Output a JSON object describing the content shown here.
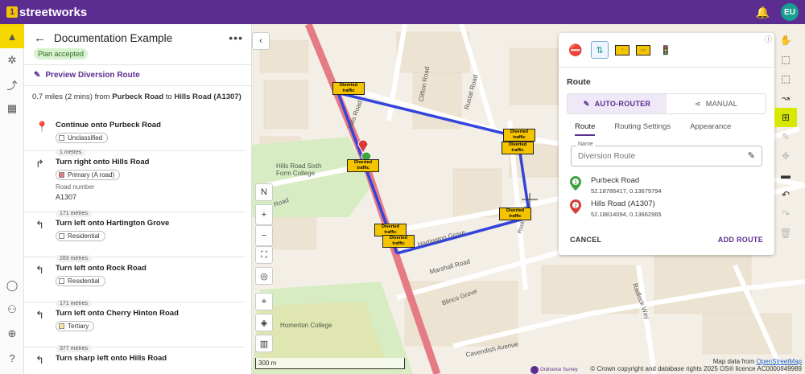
{
  "app": {
    "name": "streetworks",
    "avatar_initials": "EU"
  },
  "panel": {
    "title": "Documentation Example",
    "status_badge": "Plan accepted",
    "preview_link": "Preview Diversion Route",
    "summary": {
      "distance": "0.7 miles (2 mins) from ",
      "from": "Purbeck Road",
      "to_text": " to ",
      "to": "Hills Road (A1307)"
    },
    "steps": [
      {
        "icon": "start-pin-icon",
        "glyph": "⬤",
        "title": "Continue onto Purbeck Road",
        "chip": "Unclassified",
        "chip_color": "#ffffff",
        "distance": "1 metres"
      },
      {
        "icon": "turn-right-icon",
        "glyph": "↱",
        "title": "Turn right onto Hills Road",
        "chip": "Primary (A road)",
        "chip_color": "#e57b85",
        "sub_label": "Road number",
        "sub_value": "A1307",
        "distance": "171 metres"
      },
      {
        "icon": "turn-left-icon",
        "glyph": "↰",
        "title": "Turn left onto Hartington Grove",
        "chip": "Residential",
        "chip_color": "#ffffff",
        "distance": "283 metres"
      },
      {
        "icon": "turn-left-icon",
        "glyph": "↰",
        "title": "Turn left onto Rock Road",
        "chip": "Residential",
        "chip_color": "#ffffff",
        "distance": "171 metres"
      },
      {
        "icon": "turn-left-icon",
        "glyph": "↰",
        "title": "Turn left onto Cherry Hinton Road",
        "chip": "Tertiary",
        "chip_color": "#f8e79a",
        "distance": "377 metres"
      },
      {
        "icon": "turn-sharp-left-icon",
        "glyph": "↰",
        "title": "Turn sharp left onto Hills Road"
      }
    ]
  },
  "map": {
    "streets": [
      "Clifton Road",
      "Rustat Road",
      "Hills Road",
      "Hartington Grove",
      "Marshall Road",
      "Blinco Grove",
      "Cavendish Avenue",
      "Hills Road",
      "Rock Road",
      "Radlock Way"
    ],
    "pois": [
      "Hills Road Sixth Form College",
      "Homerton College"
    ],
    "scale": "300 m",
    "attribution_prefix": "Map data from ",
    "attribution_link": "OpenStreetMap",
    "copyright": "© Crown copyright and database rights 2025 OS® licence AC0000849989",
    "os_label": "Ordnance Survey",
    "sign_text": "Diverted traffic",
    "route_color": "#3344dd"
  },
  "route_card": {
    "section_label": "Route",
    "mode_auto": "AUTO-ROUTER",
    "mode_manual": "MANUAL",
    "tabs": [
      "Route",
      "Routing Settings",
      "Appearance"
    ],
    "name_label": "Name",
    "name_placeholder": "Diversion Route",
    "waypoints": [
      {
        "number": "1",
        "name": "Purbeck Road",
        "coords": "52.18786417, 0.13679794",
        "color": "#3fa33f"
      },
      {
        "number": "2",
        "name": "Hills Road (A1307)",
        "coords": "52.18814094, 0.13662965",
        "color": "#d93a3a"
      }
    ],
    "cancel": "CANCEL",
    "add": "ADD ROUTE"
  }
}
